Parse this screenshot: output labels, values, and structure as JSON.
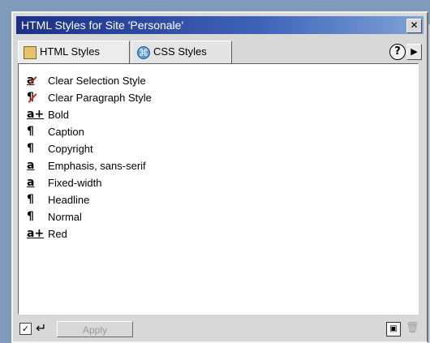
{
  "window": {
    "title": "HTML Styles for Site 'Personale'"
  },
  "tabs": [
    {
      "label": "HTML Styles",
      "icon": "html-styles-icon",
      "active": true
    },
    {
      "label": "CSS Styles",
      "icon": "css-styles-icon",
      "active": false
    }
  ],
  "styles": [
    {
      "label": "Clear Selection Style",
      "icon": "clear-selection-style-icon",
      "glyph": "a"
    },
    {
      "label": "Clear Paragraph Style",
      "icon": "clear-paragraph-style-icon",
      "glyph": "¶"
    },
    {
      "label": "Bold",
      "icon": "selection-style-additive-icon",
      "glyph": "a+"
    },
    {
      "label": "Caption",
      "icon": "paragraph-style-icon",
      "glyph": "¶"
    },
    {
      "label": "Copyright",
      "icon": "paragraph-style-icon",
      "glyph": "¶"
    },
    {
      "label": "Emphasis, sans-serif",
      "icon": "selection-style-icon",
      "glyph": "a"
    },
    {
      "label": "Fixed-width",
      "icon": "selection-style-icon",
      "glyph": "a"
    },
    {
      "label": "Headline",
      "icon": "paragraph-style-icon",
      "glyph": "¶"
    },
    {
      "label": "Normal",
      "icon": "paragraph-style-icon",
      "glyph": "¶"
    },
    {
      "label": "Red",
      "icon": "selection-style-additive-icon",
      "glyph": "a+"
    }
  ],
  "footer": {
    "apply_label": "Apply",
    "auto_apply_checked": true
  },
  "icons": {
    "help": "?",
    "menu_arrow": "▶",
    "close": "✕",
    "return": "↵",
    "check": "✓",
    "new": "▣",
    "trash": "🗑"
  },
  "colors": {
    "titlebar_start": "#1b2f86",
    "titlebar_end": "#7fa3d8",
    "panel_bg": "#d8d8d8",
    "list_bg": "#ffffff",
    "clear_stroke": "#c0301c"
  }
}
